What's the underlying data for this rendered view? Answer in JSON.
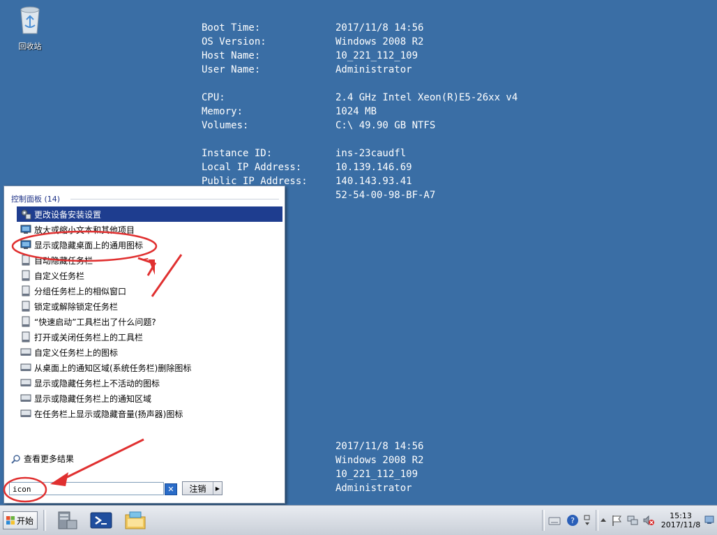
{
  "desktop": {
    "recycle_bin_label": "回收站"
  },
  "bginfo": {
    "labels": [
      "Boot Time:",
      "OS Version:",
      "Host Name:",
      "User Name:",
      "",
      "CPU:",
      "Memory:",
      "Volumes:",
      "",
      "Instance ID:",
      "Local IP Address:",
      "Public IP Address:"
    ],
    "values": [
      "2017/11/8 14:56",
      "Windows 2008 R2",
      "10_221_112_109",
      "Administrator",
      "",
      "2.4 GHz Intel Xeon(R)E5-26xx v4",
      "1024 MB",
      "C:\\ 49.90 GB NTFS",
      "",
      "ins-23caudfl",
      "10.139.146.69",
      "140.143.93.41",
      "52-54-00-98-BF-A7"
    ],
    "values_lower": [
      "2017/11/8 14:56",
      "Windows 2008 R2",
      "10_221_112_109",
      "Administrator"
    ]
  },
  "start_menu": {
    "group_title": "控制面板 (14)",
    "results": [
      {
        "label": "更改设备安装设置",
        "icon": "device-settings-icon",
        "selected": true
      },
      {
        "label": "放大或缩小文本和其他项目",
        "icon": "display-icon"
      },
      {
        "label": "显示或隐藏桌面上的通用图标",
        "icon": "display-icon"
      },
      {
        "label": "自动隐藏任务栏",
        "icon": "taskbar-icon"
      },
      {
        "label": "自定义任务栏",
        "icon": "taskbar-icon"
      },
      {
        "label": "分组任务栏上的相似窗口",
        "icon": "taskbar-icon"
      },
      {
        "label": "锁定或解除锁定任务栏",
        "icon": "taskbar-icon"
      },
      {
        "label": "“快速启动”工具栏出了什么问题?",
        "icon": "taskbar-icon"
      },
      {
        "label": "打开或关闭任务栏上的工具栏",
        "icon": "taskbar-icon"
      },
      {
        "label": "自定义任务栏上的图标",
        "icon": "notification-area-icon"
      },
      {
        "label": "从桌面上的通知区域(系统任务栏)删除图标",
        "icon": "notification-area-icon"
      },
      {
        "label": "显示或隐藏任务栏上不活动的图标",
        "icon": "notification-area-icon"
      },
      {
        "label": "显示或隐藏任务栏上的通知区域",
        "icon": "notification-area-icon"
      },
      {
        "label": "在任务栏上显示或隐藏音量(扬声器)图标",
        "icon": "notification-area-icon"
      }
    ],
    "see_more": "查看更多结果",
    "search_value": "icon",
    "logoff_label": "注销"
  },
  "taskbar": {
    "start_label": "开始",
    "clock_time": "15:13",
    "clock_date": "2017/11/8"
  },
  "colors": {
    "desktop": "#3a6ea5",
    "selection": "#1e3d8f",
    "annotation_red": "#e03030"
  }
}
